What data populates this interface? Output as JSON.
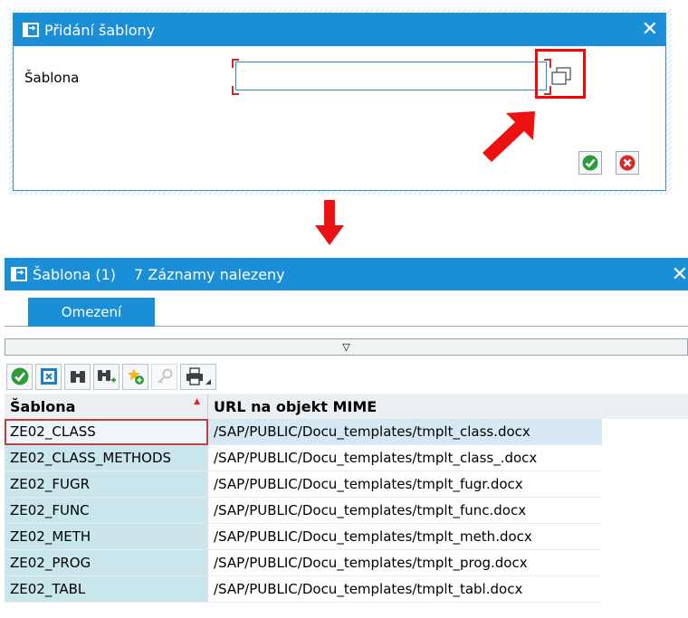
{
  "dialog1": {
    "title": "Přidání šablony",
    "field_label": "Šablona",
    "field_value": "",
    "close_glyph": "✕",
    "icons": [
      "dialog-icon",
      "value-help-icon",
      "confirm-icon",
      "cancel-icon"
    ]
  },
  "dialog2": {
    "title": "Šablona (1)",
    "count_text": "7 Záznamy nalezeny",
    "close_glyph": "✕",
    "tab_label": "Omezení",
    "collapse_glyph": "▽",
    "toolbar_icons": [
      "confirm-icon",
      "select-all-icon",
      "find-icon",
      "find-next-icon",
      "favorite-add-icon",
      "key-icon",
      "print-icon"
    ],
    "columns": [
      "Šablona",
      "URL na objekt MIME"
    ],
    "rows": [
      {
        "name": "ZE02_CLASS",
        "url": "/SAP/PUBLIC/Docu_templates/tmplt_class.docx"
      },
      {
        "name": "ZE02_CLASS_METHODS",
        "url": "/SAP/PUBLIC/Docu_templates/tmplt_class_.docx"
      },
      {
        "name": "ZE02_FUGR",
        "url": "/SAP/PUBLIC/Docu_templates/tmplt_fugr.docx"
      },
      {
        "name": "ZE02_FUNC",
        "url": "/SAP/PUBLIC/Docu_templates/tmplt_func.docx"
      },
      {
        "name": "ZE02_METH",
        "url": "/SAP/PUBLIC/Docu_templates/tmplt_meth.docx"
      },
      {
        "name": "ZE02_PROG",
        "url": "/SAP/PUBLIC/Docu_templates/tmplt_prog.docx"
      },
      {
        "name": "ZE02_TABL",
        "url": "/SAP/PUBLIC/Docu_templates/tmplt_tabl.docx"
      }
    ]
  },
  "colors": {
    "titlebar": "#1a8fd8",
    "highlight": "#ff0000",
    "column_shade": "#c8e6ec",
    "confirm": "#2e9a3a",
    "cancel": "#d42a2a"
  }
}
